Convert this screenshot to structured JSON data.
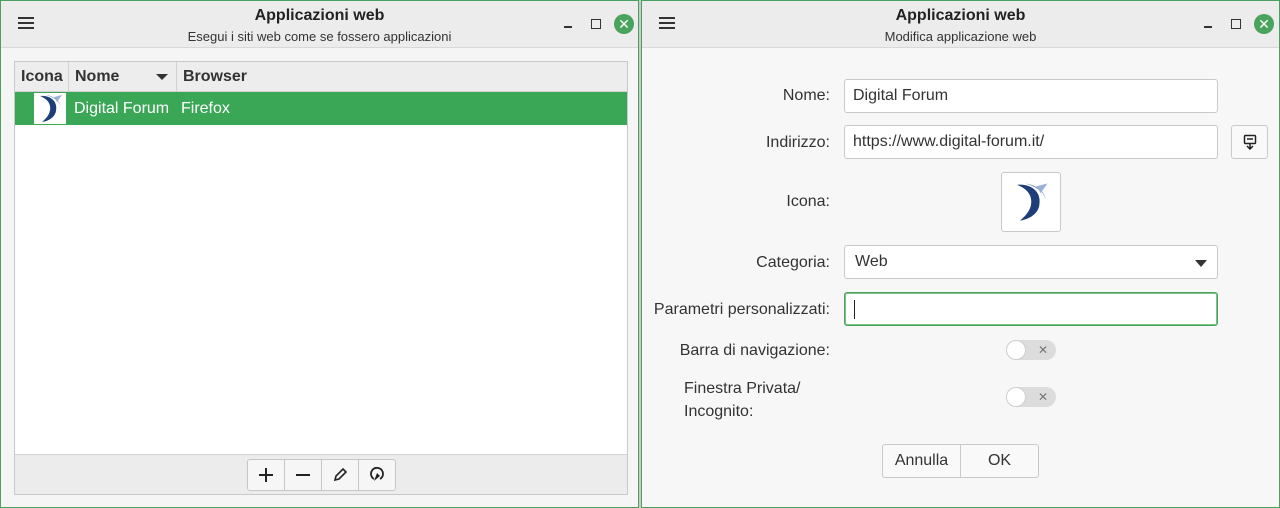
{
  "left_window": {
    "title": "Applicazioni web",
    "subtitle": "Esegui i siti web come se fossero applicazioni",
    "menu_icon": "hamburger-menu-icon",
    "columns": [
      "Icona",
      "Nome",
      "Browser"
    ],
    "rows": [
      {
        "name": "Digital Forum",
        "browser": "Firefox",
        "icon": "digital-forum-logo"
      }
    ],
    "toolbar": {
      "add_icon": "plus-icon",
      "remove_icon": "minus-icon",
      "edit_icon": "pencil-icon",
      "launch_icon": "launch-icon"
    }
  },
  "right_window": {
    "title": "Applicazioni web",
    "subtitle": "Modifica applicazione web",
    "form": {
      "name_label": "Nome:",
      "name_value": "Digital Forum",
      "address_label": "Indirizzo:",
      "address_value": "https://www.digital-forum.it/",
      "icon_label": "Icona:",
      "category_label": "Categoria:",
      "category_value": "Web",
      "params_label": "Parametri personalizzati:",
      "params_value": "",
      "navbar_label": "Barra di navigazione:",
      "navbar_enabled": false,
      "private_label_line1": "Finestra Privata/",
      "private_label_line2": "Incognito:",
      "private_enabled": false
    },
    "buttons": {
      "cancel": "Annulla",
      "ok": "OK"
    }
  },
  "colors": {
    "accent": "#3aa756",
    "close": "#4aa35d",
    "logo_blue": "#2b4a8c"
  }
}
